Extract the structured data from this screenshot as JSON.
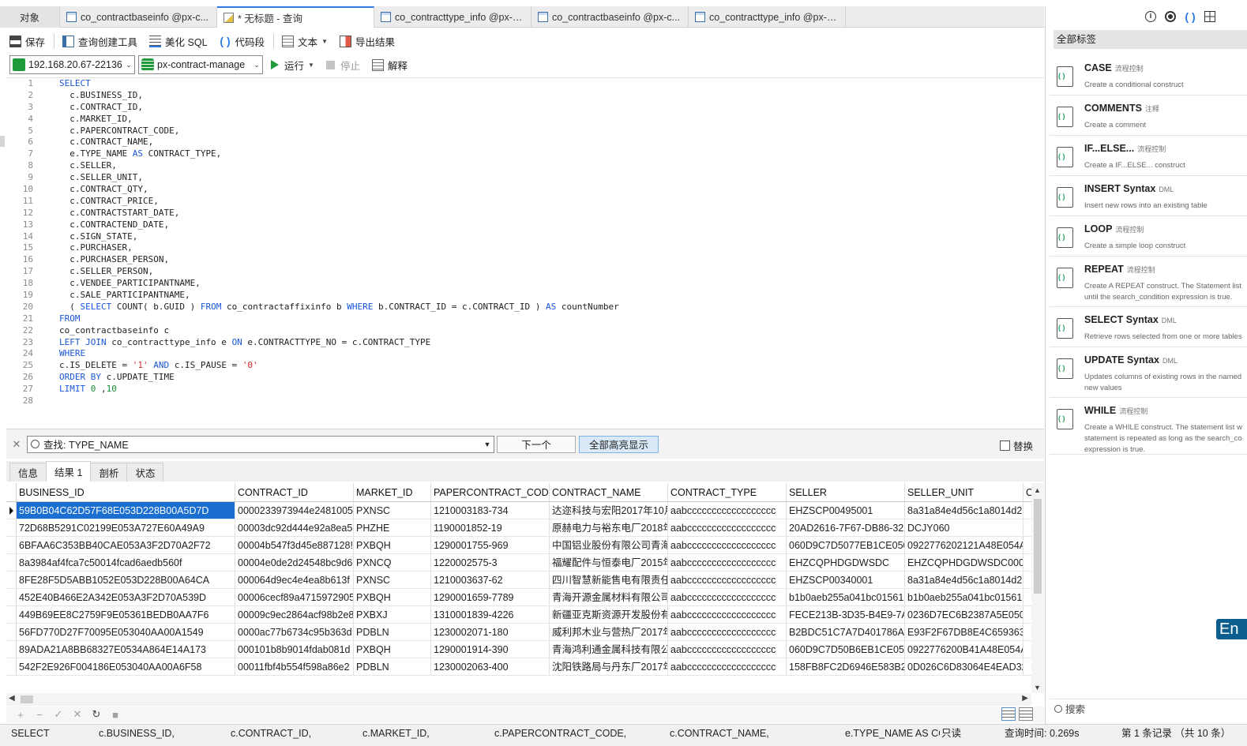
{
  "tabs": [
    {
      "label": "对象",
      "icon": ""
    },
    {
      "label": "co_contractbaseinfo @px-c...",
      "icon": "table-icon"
    },
    {
      "label": "* 无标题 - 查询",
      "icon": "query-icon"
    },
    {
      "label": "co_contracttype_info @px-c...",
      "icon": "table-icon"
    },
    {
      "label": "co_contractbaseinfo @px-c...",
      "icon": "table-edit-icon"
    },
    {
      "label": "co_contracttype_info @px-c...",
      "icon": "table-edit-icon"
    }
  ],
  "toolbar1": {
    "save": "保存",
    "query_builder": "查询创建工具",
    "beautify": "美化 SQL",
    "code_snippet": "代码段",
    "text": "文本",
    "export": "导出结果"
  },
  "toolbar2": {
    "connection": "192.168.20.67-22136",
    "database": "px-contract-manage",
    "run": "运行",
    "stop": "停止",
    "explain": "解释"
  },
  "editor": {
    "line_numbers": [
      "1",
      "2",
      "3",
      "4",
      "5",
      "6",
      "7",
      "8",
      "9",
      "10",
      "11",
      "12",
      "13",
      "14",
      "15",
      "16",
      "17",
      "18",
      "19",
      "20",
      "21",
      "22",
      "23",
      "24",
      "25",
      "26",
      "27",
      "28"
    ]
  },
  "find": {
    "value": "查找: TYPE_NAME",
    "next": "下一个",
    "highlight_all": "全部高亮显示",
    "replace": "替换"
  },
  "result_tabs": [
    "信息",
    "结果 1",
    "剖析",
    "状态"
  ],
  "grid": {
    "columns": [
      "BUSINESS_ID",
      "CONTRACT_ID",
      "MARKET_ID",
      "PAPERCONTRACT_CODE",
      "CONTRACT_NAME",
      "CONTRACT_TYPE",
      "SELLER",
      "SELLER_UNIT",
      "C"
    ],
    "rows": [
      [
        "59B0B04C62D57F68E053D228B00A5D7D",
        "0000233973944e2481005",
        "PXNSC",
        "1210003183-734",
        "达迩科技与宏阳2017年10月",
        "aabcccccccccccccccccc",
        "EHZSCP00495001",
        "8a31a84e4d56c1a8014d2",
        ""
      ],
      [
        "72D68B5291C02199E053A727E60A49A9",
        "00003dc92d444e92a8ea5",
        "PHZHE",
        "1190001852-19",
        "原赫电力与裕东电厂2018年",
        "aabcccccccccccccccccc",
        "20AD2616-7F67-DB86-32I",
        "DCJY060",
        ""
      ],
      [
        "6BFAA6C353BB40CAE053A3F2D70A2F72",
        "00004b547f3d45e887128!",
        "PXBQH",
        "1290001755-969",
        "中国铝业股份有限公司青海分",
        "aabcccccccccccccccccc",
        "060D9C7D5077EB1CE050",
        "0922776202121A48E054A",
        ""
      ],
      [
        "8a3984af4fca7c50014fcad6aedb560f",
        "00004e0de2d24548bc9d6",
        "PXNCQ",
        "1220002575-3",
        "福耀配件与恒泰电厂2015年",
        "aabcccccccccccccccccc",
        "EHZCQPHDGDWSDC",
        "EHZCQPHDGDWSDC0001",
        ""
      ],
      [
        "8FE28F5D5ABB1052E053D228B00A64CA",
        "000064d9ec4e4ea8b613f",
        "PXNSC",
        "1210003637-62",
        "四川智慧新能售电有限责任公",
        "aabcccccccccccccccccc",
        "EHZSCP00340001",
        "8a31a84e4d56c1a8014d2",
        ""
      ],
      [
        "452E40B466E2A342E053A3F2D70A539D",
        "00006cecf89a4715972905",
        "PXBQH",
        "1290001659-7789",
        "青海开源金属材料有限公司与",
        "aabcccccccccccccccccc",
        "b1b0aeb255a041bc01561",
        "b1b0aeb255a041bc01561",
        ""
      ],
      [
        "449B69EE8C2759F9E05361BEDB0AA7F6",
        "00009c9ec2864acf98b2e8",
        "PXBXJ",
        "1310001839-4226",
        "新疆亚克斯资源开发股份有限",
        "aabcccccccccccccccccc",
        "FECE213B-3D35-B4E9-7AI",
        "0236D7EC6B2387A5E050(",
        ""
      ],
      [
        "56FD770D27F70095E053040AA00A1549",
        "0000ac77b6734c95b363d",
        "PDBLN",
        "1230002071-180",
        "威利邦木业与营热厂2017年",
        "aabcccccccccccccccccc",
        "B2BDC51C7A7D401786A7",
        "E93F2F67DB8E4C6593632",
        ""
      ],
      [
        "89ADA21A8BB68327E0534A864E14A173",
        "000101b8b9014fdab081d",
        "PXBQH",
        "1290001914-390",
        "青海鸿利通金属科技有限公司",
        "aabcccccccccccccccccc",
        "060D9C7D50B6EB1CE050",
        "0922776200B41A48E054A",
        ""
      ],
      [
        "542F2E926F004186E053040AA00A6F58",
        "00011fbf4b554f598a86e2",
        "PDBLN",
        "1230002063-400",
        "沈阳铁路局与丹东厂2017年",
        "aabcccccccccccccccccc",
        "158FB8FC2D6946E583B2C",
        "0D026C6D83064E4EAD32",
        ""
      ]
    ]
  },
  "statusbar": {
    "cols": [
      "SELECT",
      "c.BUSINESS_ID,",
      "c.CONTRACT_ID,",
      "c.MARKET_ID,",
      "c.PAPERCONTRACT_CODE,",
      "c.CONTRACT_NAME,",
      "e.TYPE_NAME AS CC"
    ],
    "readonly": "只读",
    "query_time": "查询时间: 0.269s",
    "record": "第 1 条记录 （共 10 条）"
  },
  "right_panel": {
    "filter": "全部标签",
    "search": "搜索",
    "snippets": [
      {
        "title": "CASE",
        "tag": "流程控制",
        "desc": [
          "Create a conditional construct"
        ]
      },
      {
        "title": "COMMENTS",
        "tag": "注释",
        "desc": [
          "Create a comment"
        ]
      },
      {
        "title": "IF...ELSE...",
        "tag": "流程控制",
        "desc": [
          "Create a IF...ELSE... construct"
        ]
      },
      {
        "title": "INSERT Syntax",
        "tag": "DML",
        "desc": [
          "Insert new rows into an existing table"
        ]
      },
      {
        "title": "LOOP",
        "tag": "流程控制",
        "desc": [
          "Create a simple loop construct"
        ]
      },
      {
        "title": "REPEAT",
        "tag": "流程控制",
        "desc": [
          "Create A REPEAT construct. The Statement list",
          "until the search_condition expression is true."
        ]
      },
      {
        "title": "SELECT Syntax",
        "tag": "DML",
        "desc": [
          "Retrieve rows selected from one or more tables"
        ]
      },
      {
        "title": "UPDATE Syntax",
        "tag": "DML",
        "desc": [
          "Updates columns of existing rows in the named",
          "new values"
        ]
      },
      {
        "title": "WHILE",
        "tag": "流程控制",
        "desc": [
          "Create a WHILE construct. The statement list w",
          "statement is repeated as long as the search_co",
          "expression is true."
        ]
      }
    ]
  },
  "ime": "En"
}
